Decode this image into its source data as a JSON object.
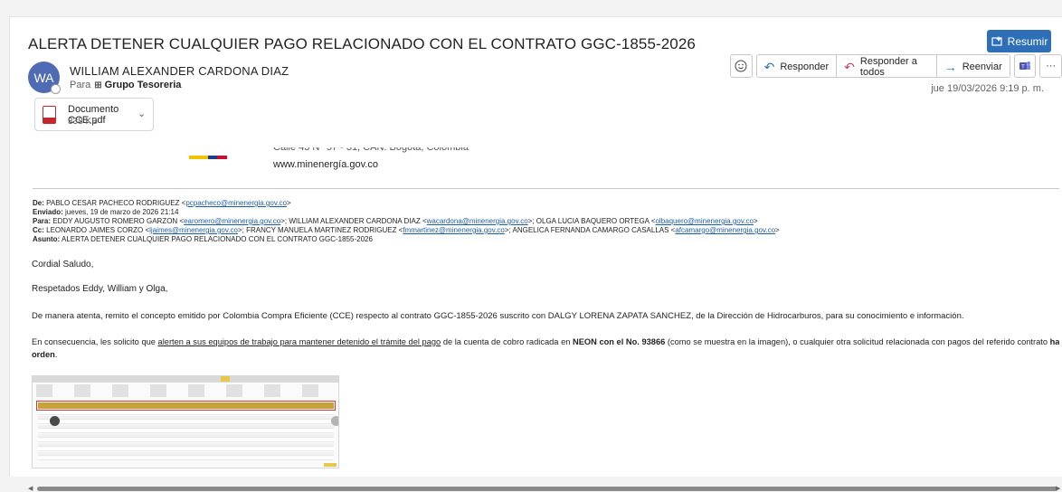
{
  "message": {
    "subject": "ALERTA DETENER CUALQUIER PAGO RELACIONADO CON EL CONTRATO GGC-1855-2026",
    "summarize_label": "Resumir",
    "sender_initials": "WA",
    "sender_name": "WILLIAM ALEXANDER CARDONA DIAZ",
    "to_label": "Para",
    "to_group": "Grupo Tesoreria",
    "date": "jue 19/03/2026 9:19 p. m."
  },
  "toolbar": {
    "emoji_icon": "smiley-icon",
    "reply_label": "Responder",
    "reply_all_label": "Responder a todos",
    "forward_label": "Reenviar",
    "teams_icon": "teams-icon",
    "more_label": "···"
  },
  "attachment": {
    "name": "Documento CCE.pdf",
    "size": "338 KB"
  },
  "signature": {
    "address": "Calle 43 N° 57 - 31, CAN. Bogotá, Colombia",
    "website": "www.minenergía.gov.co"
  },
  "forwarded": {
    "from_label": "De:",
    "from_name": "PABLO CESAR PACHECO RODRIGUEZ <",
    "from_email": "pcpacheco@minenergia.gov.co",
    "from_close": ">",
    "sent_label": "Enviado:",
    "sent_value": "jueves, 19 de marzo de 2026 21:14",
    "to_label": "Para:",
    "to_1_name": "EDDY AUGUSTO ROMERO GARZON <",
    "to_1_email": "earomero@minenergia.gov.co",
    "to_2_name": ">; WILLIAM ALEXANDER CARDONA DIAZ <",
    "to_2_email": "wacardona@minenergia.gov.co",
    "to_3_name": ">; OLGA LUCIA BAQUERO ORTEGA <",
    "to_3_email": "olbaquero@minenergia.gov.co",
    "to_close": ">",
    "cc_label": "Cc:",
    "cc_1_name": "LEONARDO JAIMES CORZO <",
    "cc_1_email": "ljaimes@minenergia.gov.co",
    "cc_2_name": ">; FRANCY MANUELA MARTINEZ RODRIGUEZ <",
    "cc_2_email": "fmmartinez@minenergia.gov.co",
    "cc_3_name": ">; ANGELICA FERNANDA CAMARGO CASALLAS <",
    "cc_3_email": "afcamargo@minenergia.gov.co",
    "cc_close": ">",
    "subject_label": "Asunto:",
    "subject_value": "ALERTA DETENER CUALQUIER PAGO RELACIONADO CON EL CONTRATO GGC-1855-2026"
  },
  "body": {
    "greeting": "Cordial Saludo,",
    "salutation": "Respetados Eddy, William y Olga,",
    "para1": "De manera atenta, remito el concepto emitido por Colombia Compra Eficiente (CCE) respecto al contrato GGC-1855-2026 suscrito con DALGY LORENA ZAPATA SANCHEZ, de la Dirección de Hidrocarburos, para su conocimiento e información.",
    "para2_a": "En consecuencia, les solicito que ",
    "para2_u": "alerten a sus equipos de trabajo para mantener detenido el trámite del pago",
    "para2_b": " de la cuenta de cobro radicada en ",
    "para2_bold1": "NEON con el No. 93866",
    "para2_c": " (como se muestra en la imagen), o cualquier otra solicitud relacionada con pagos del referido contrato ",
    "para2_bold2": "hasta nueva",
    "para2_bold3": "orden",
    "para2_end": "."
  },
  "colors": {
    "accent": "#2e6fb8",
    "avatar": "#4f6bb3",
    "link": "#1f5fa8",
    "highlight_box": "#d23a3a",
    "table_header": "#c7a23a"
  }
}
